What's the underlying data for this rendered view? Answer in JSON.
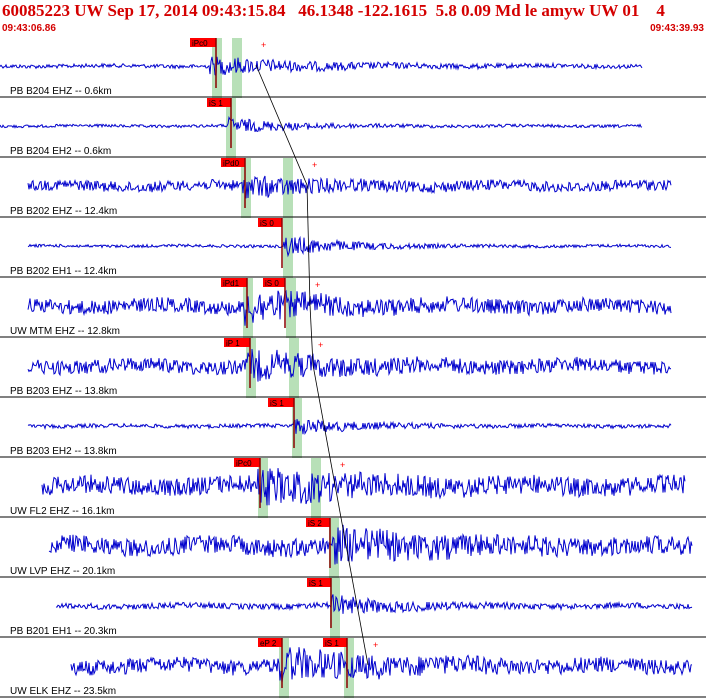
{
  "header": {
    "title": "60085223 UW Sep 17, 2014 09:43:15.84   46.1348 -122.1615  5.8 0.09 Md le amyw UW 01    4",
    "time_start": "09:43:06.86",
    "time_end": "09:43:39.93"
  },
  "colors": {
    "text": "#d40000",
    "trace": "#0000cc",
    "pick_box": "#ff0000",
    "pick_line": "#8b0000",
    "window_band": "#b8e0b8",
    "separator": "#000000"
  },
  "channels": [
    {
      "label": "PB B204 EHZ -- 0.6km",
      "picks": [
        {
          "text": "iPc0"
        }
      ],
      "arrival": 8.2,
      "tail": 3.5,
      "amp": 0.35,
      "noise": 0.08,
      "start": 0.0,
      "end": 0.91
    },
    {
      "label": "PB B204 EH2 -- 0.6km",
      "picks": [
        {
          "text": "iS 1"
        }
      ],
      "arrival": 0.0,
      "tail": 2.0,
      "amp": 0.3,
      "noise": 0.06,
      "start": 0.0,
      "end": 0.91
    },
    {
      "label": "PB B202 EHZ -- 12.4km",
      "picks": [
        {
          "text": "iPd0"
        }
      ],
      "arrival": 0.0,
      "tail": 2.0,
      "amp": 0.35,
      "noise": 0.22,
      "start": 0.04,
      "end": 0.95
    },
    {
      "label": "PB B202 EH1 -- 12.4km",
      "picks": [
        {
          "text": "iS 0"
        }
      ],
      "arrival": 0.0,
      "tail": 2.0,
      "amp": 0.4,
      "noise": 0.06,
      "start": 0.04,
      "end": 0.95
    },
    {
      "label": "UW MTM EHZ -- 12.8km",
      "picks": [
        {
          "text": "iPd1"
        },
        {
          "text": "iS 0"
        }
      ],
      "arrival": 0.0,
      "tail": 2.5,
      "amp": 0.5,
      "noise": 0.3,
      "start": 0.04,
      "end": 0.95
    },
    {
      "label": "PB B203 EHZ -- 13.8km",
      "picks": [
        {
          "text": "iP 1"
        }
      ],
      "arrival": 0.0,
      "tail": 2.5,
      "amp": 0.45,
      "noise": 0.3,
      "start": 0.04,
      "end": 0.95
    },
    {
      "label": "PB B203 EH2 -- 13.8km",
      "picks": [
        {
          "text": "iS 1"
        }
      ],
      "arrival": 0.0,
      "tail": 2.0,
      "amp": 0.3,
      "noise": 0.08,
      "start": 0.04,
      "end": 0.95
    },
    {
      "label": "UW FL2 EHZ -- 16.1km",
      "picks": [
        {
          "text": "iPc0"
        },
        {
          "text": ""
        }
      ],
      "arrival": 0.0,
      "tail": 3.0,
      "amp": 0.5,
      "noise": 0.38,
      "start": 0.06,
      "end": 0.97
    },
    {
      "label": "UW LVP EHZ -- 20.1km",
      "picks": [
        {
          "text": "iS 2"
        }
      ],
      "arrival": 0.0,
      "tail": 3.0,
      "amp": 0.5,
      "noise": 0.38,
      "start": 0.07,
      "end": 0.98
    },
    {
      "label": "PB B201 EH1 -- 20.3km",
      "picks": [
        {
          "text": "iS 1"
        }
      ],
      "arrival": 0.0,
      "tail": 2.0,
      "amp": 0.35,
      "noise": 0.12,
      "start": 0.08,
      "end": 0.98
    },
    {
      "label": "UW ELK EHZ -- 23.5km",
      "picks": [
        {
          "text": "eP 2"
        },
        {
          "text": "iS 1"
        }
      ],
      "arrival": 0.0,
      "tail": 3.0,
      "amp": 0.5,
      "noise": 0.32,
      "start": 0.1,
      "end": 0.98
    }
  ]
}
